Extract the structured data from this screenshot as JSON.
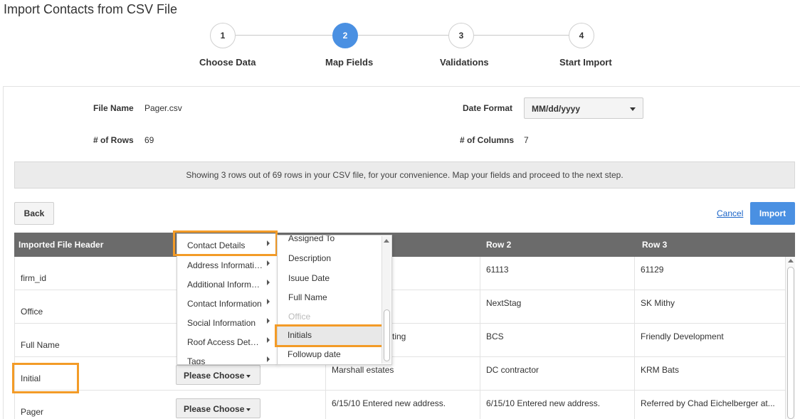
{
  "page": {
    "title": "Import Contacts from CSV File"
  },
  "stepper": {
    "steps": [
      {
        "number": "1",
        "label": "Choose Data"
      },
      {
        "number": "2",
        "label": "Map Fields"
      },
      {
        "number": "3",
        "label": "Validations"
      },
      {
        "number": "4",
        "label": "Start Import"
      }
    ],
    "active_step": 2
  },
  "file_info": {
    "file_name_label": "File Name",
    "file_name": "Pager.csv",
    "rows_label": "# of Rows",
    "rows": "69",
    "date_format_label": "Date Format",
    "date_format": "MM/dd/yyyy",
    "columns_label": "# of Columns",
    "columns": "7"
  },
  "banner": {
    "text": "Showing 3 rows out of 69 rows in your CSV file, for your convenience. Map your fields and proceed to the next step."
  },
  "actions": {
    "back": "Back",
    "cancel": "Cancel",
    "import": "Import"
  },
  "table": {
    "headers": [
      "Imported File Header",
      "Row 2",
      "Row 3"
    ],
    "rows": [
      {
        "header": "firm_id",
        "r1": "",
        "r2": "61113",
        "r3": "61129"
      },
      {
        "header": "Office",
        "r1": "",
        "r2": "NextStag",
        "r3": "SK Mithy"
      },
      {
        "header": "Full Name",
        "r1": "ting",
        "r2": "BCS",
        "r3": "Friendly Development"
      },
      {
        "header": "Initial",
        "r1": "Marshall estates",
        "r2": "DC contractor",
        "r3": "KRM Bats",
        "choose": "Please Choose"
      },
      {
        "header": "Pager",
        "r1": "6/15/10 Entered new address.",
        "r2": "6/15/10 Entered new address.",
        "r3": "Referred by Chad Eichelberger at...",
        "choose": "Please Choose"
      }
    ]
  },
  "category_menu": {
    "items": [
      "Contact Details",
      "Address Informati…",
      "Additional Inform…",
      "Contact Information",
      "Social Information",
      "Roof Access Det…",
      "Tags"
    ]
  },
  "field_menu": {
    "items": [
      "Assigned To",
      "Description",
      "Isuue Date",
      "Full Name",
      "Office",
      "Initials",
      "Followup date"
    ],
    "selected": "Initials",
    "disabled": "Office"
  },
  "colors": {
    "accent": "#4a90e2",
    "highlight": "#f39b27",
    "header_bg": "#6b6b6b"
  }
}
